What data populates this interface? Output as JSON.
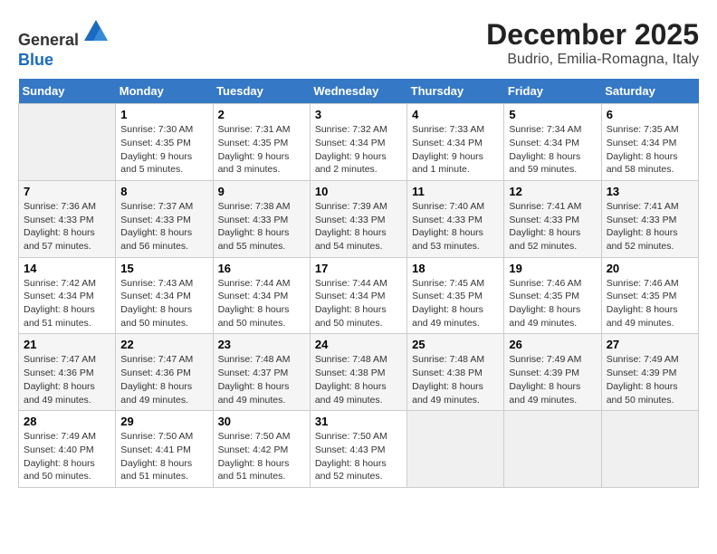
{
  "header": {
    "logo_general": "General",
    "logo_blue": "Blue",
    "month": "December 2025",
    "location": "Budrio, Emilia-Romagna, Italy"
  },
  "weekdays": [
    "Sunday",
    "Monday",
    "Tuesday",
    "Wednesday",
    "Thursday",
    "Friday",
    "Saturday"
  ],
  "weeks": [
    [
      {
        "day": "",
        "empty": true
      },
      {
        "day": "1",
        "sunrise": "7:30 AM",
        "sunset": "4:35 PM",
        "daylight": "9 hours and 5 minutes."
      },
      {
        "day": "2",
        "sunrise": "7:31 AM",
        "sunset": "4:35 PM",
        "daylight": "9 hours and 3 minutes."
      },
      {
        "day": "3",
        "sunrise": "7:32 AM",
        "sunset": "4:34 PM",
        "daylight": "9 hours and 2 minutes."
      },
      {
        "day": "4",
        "sunrise": "7:33 AM",
        "sunset": "4:34 PM",
        "daylight": "9 hours and 1 minute."
      },
      {
        "day": "5",
        "sunrise": "7:34 AM",
        "sunset": "4:34 PM",
        "daylight": "8 hours and 59 minutes."
      },
      {
        "day": "6",
        "sunrise": "7:35 AM",
        "sunset": "4:34 PM",
        "daylight": "8 hours and 58 minutes."
      }
    ],
    [
      {
        "day": "7",
        "sunrise": "7:36 AM",
        "sunset": "4:33 PM",
        "daylight": "8 hours and 57 minutes."
      },
      {
        "day": "8",
        "sunrise": "7:37 AM",
        "sunset": "4:33 PM",
        "daylight": "8 hours and 56 minutes."
      },
      {
        "day": "9",
        "sunrise": "7:38 AM",
        "sunset": "4:33 PM",
        "daylight": "8 hours and 55 minutes."
      },
      {
        "day": "10",
        "sunrise": "7:39 AM",
        "sunset": "4:33 PM",
        "daylight": "8 hours and 54 minutes."
      },
      {
        "day": "11",
        "sunrise": "7:40 AM",
        "sunset": "4:33 PM",
        "daylight": "8 hours and 53 minutes."
      },
      {
        "day": "12",
        "sunrise": "7:41 AM",
        "sunset": "4:33 PM",
        "daylight": "8 hours and 52 minutes."
      },
      {
        "day": "13",
        "sunrise": "7:41 AM",
        "sunset": "4:33 PM",
        "daylight": "8 hours and 52 minutes."
      }
    ],
    [
      {
        "day": "14",
        "sunrise": "7:42 AM",
        "sunset": "4:34 PM",
        "daylight": "8 hours and 51 minutes."
      },
      {
        "day": "15",
        "sunrise": "7:43 AM",
        "sunset": "4:34 PM",
        "daylight": "8 hours and 50 minutes."
      },
      {
        "day": "16",
        "sunrise": "7:44 AM",
        "sunset": "4:34 PM",
        "daylight": "8 hours and 50 minutes."
      },
      {
        "day": "17",
        "sunrise": "7:44 AM",
        "sunset": "4:34 PM",
        "daylight": "8 hours and 50 minutes."
      },
      {
        "day": "18",
        "sunrise": "7:45 AM",
        "sunset": "4:35 PM",
        "daylight": "8 hours and 49 minutes."
      },
      {
        "day": "19",
        "sunrise": "7:46 AM",
        "sunset": "4:35 PM",
        "daylight": "8 hours and 49 minutes."
      },
      {
        "day": "20",
        "sunrise": "7:46 AM",
        "sunset": "4:35 PM",
        "daylight": "8 hours and 49 minutes."
      }
    ],
    [
      {
        "day": "21",
        "sunrise": "7:47 AM",
        "sunset": "4:36 PM",
        "daylight": "8 hours and 49 minutes."
      },
      {
        "day": "22",
        "sunrise": "7:47 AM",
        "sunset": "4:36 PM",
        "daylight": "8 hours and 49 minutes."
      },
      {
        "day": "23",
        "sunrise": "7:48 AM",
        "sunset": "4:37 PM",
        "daylight": "8 hours and 49 minutes."
      },
      {
        "day": "24",
        "sunrise": "7:48 AM",
        "sunset": "4:38 PM",
        "daylight": "8 hours and 49 minutes."
      },
      {
        "day": "25",
        "sunrise": "7:48 AM",
        "sunset": "4:38 PM",
        "daylight": "8 hours and 49 minutes."
      },
      {
        "day": "26",
        "sunrise": "7:49 AM",
        "sunset": "4:39 PM",
        "daylight": "8 hours and 49 minutes."
      },
      {
        "day": "27",
        "sunrise": "7:49 AM",
        "sunset": "4:39 PM",
        "daylight": "8 hours and 50 minutes."
      }
    ],
    [
      {
        "day": "28",
        "sunrise": "7:49 AM",
        "sunset": "4:40 PM",
        "daylight": "8 hours and 50 minutes."
      },
      {
        "day": "29",
        "sunrise": "7:50 AM",
        "sunset": "4:41 PM",
        "daylight": "8 hours and 51 minutes."
      },
      {
        "day": "30",
        "sunrise": "7:50 AM",
        "sunset": "4:42 PM",
        "daylight": "8 hours and 51 minutes."
      },
      {
        "day": "31",
        "sunrise": "7:50 AM",
        "sunset": "4:43 PM",
        "daylight": "8 hours and 52 minutes."
      },
      {
        "day": "",
        "empty": true
      },
      {
        "day": "",
        "empty": true
      },
      {
        "day": "",
        "empty": true
      }
    ]
  ]
}
